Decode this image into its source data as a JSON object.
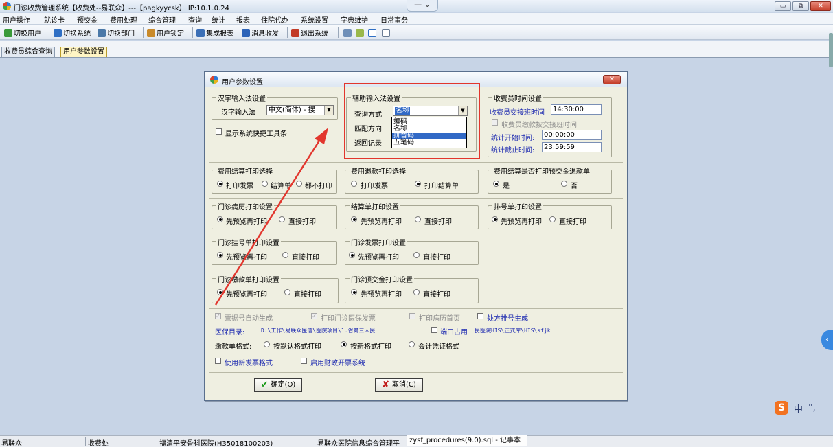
{
  "window": {
    "title": "门诊收费管理系统【收费处--易联众】---【pagkyycsk】 IP:10.1.0.24",
    "tab_controls": "—  ⌄",
    "buttons": {
      "minimize": "▭",
      "restore": "⧉",
      "close": "✕"
    }
  },
  "menu": [
    "用户操作",
    "就诊卡",
    "预交金",
    "费用处理",
    "综合管理",
    "查询",
    "统计",
    "报表",
    "住院代办",
    "系统设置",
    "字典维护",
    "日常事务"
  ],
  "toolbar": {
    "items": [
      {
        "label": "切换用户",
        "icon": "switch-user-icon",
        "color": "#3a9a3a"
      },
      {
        "label": "切换系统",
        "icon": "switch-system-icon",
        "color": "#2f6fc4"
      },
      {
        "label": "切换部门",
        "icon": "switch-department-icon",
        "color": "#4a78a8"
      },
      {
        "label": "用户锁定",
        "icon": "user-lock-icon",
        "color": "#c98a2a"
      },
      {
        "label": "集成报表",
        "icon": "report-icon",
        "color": "#3b6fb6"
      },
      {
        "label": "消息收发",
        "icon": "message-icon",
        "color": "#2c63b8"
      },
      {
        "label": "退出系统",
        "icon": "exit-icon",
        "color": "#c23a26"
      }
    ],
    "extra_icons": [
      "help-icon",
      "plugin-icon",
      "layout-icon",
      "window-icon"
    ]
  },
  "tabs": [
    "收费员综合查询",
    "用户参数设置"
  ],
  "dialog": {
    "title": "用户参数设置",
    "close_label": "✕",
    "ime_group": {
      "title": "汉字输入法设置",
      "label": "汉字输入法",
      "value": "中文(简体) - 搜",
      "show_toolbar": "显示系统快捷工具条"
    },
    "aux_group": {
      "title": "辅助输入法设置",
      "query_label": "查询方式",
      "query_value": "名称",
      "match_label": "匹配方向",
      "return_label": "返回记录",
      "options": [
        "编码",
        "名称",
        "拼音码",
        "五笔码"
      ]
    },
    "time_group": {
      "title": "收费员时间设置",
      "handover_label": "收费员交接班时间",
      "handover_value": "14:30:00",
      "pay_handover": "收费员缴款按交接班时间",
      "start_label": "统计开始时间:",
      "start_value": "00:00:00",
      "end_label": "统计截止时间:",
      "end_value": "23:59:59"
    },
    "settle_print": {
      "title": "费用结算打印选择",
      "options": [
        "打印发票",
        "结算单",
        "都不打印"
      ]
    },
    "refund_print": {
      "title": "费用退款打印选择",
      "options": [
        "打印发票",
        "打印结算单"
      ]
    },
    "deposit_refund": {
      "title": "费用结算是否打印预交金退款单",
      "options": [
        "是",
        "否"
      ]
    },
    "record_print": {
      "title": "门诊病历打印设置",
      "options": [
        "先预览再打印",
        "直接打印"
      ]
    },
    "bill_print": {
      "title": "结算单打印设置",
      "options": [
        "先预览再打印",
        "直接打印"
      ]
    },
    "queue_print": {
      "title": "排号单打印设置",
      "options": [
        "先预览再打印",
        "直接打印"
      ]
    },
    "reg_print": {
      "title": "门诊挂号单打印设置",
      "options": [
        "先预览再打印",
        "直接打印"
      ]
    },
    "invoice_print": {
      "title": "门诊发票打印设置",
      "options": [
        "先预览再打印",
        "直接打印"
      ]
    },
    "payment_print": {
      "title": "门诊缴款单打印设置",
      "options": [
        "先预览再打印",
        "直接打印"
      ]
    },
    "prepay_print": {
      "title": "门诊预交金打印设置",
      "options": [
        "先预览再打印",
        "直接打印"
      ]
    },
    "misc": {
      "auto_receipt": "票据号自动生成",
      "print_insurance": "打印门诊医保发票",
      "print_first_page": "打印病历首页",
      "prescription_queue": "处方排号生成",
      "insurance_dir_label": "医保目录:",
      "insurance_dir_value": "D:\\工作\\易联众医信\\医院项目\\1.省第三人民",
      "port_use": "端口占用",
      "port_path": "民医院HIS\\正式库\\HIS\\sfjk",
      "payment_format_label": "缴款单格式:",
      "payment_formats": [
        "按默认格式打印",
        "按新格式打印",
        "会计凭证格式"
      ],
      "new_invoice": "使用新发票格式",
      "finance_invoice": "启用财政开票系统"
    },
    "ok_label": "确定(O)",
    "cancel_label": "取消(C)"
  },
  "statusbar": {
    "cells": [
      "易联众",
      "收费处",
      "福清平安骨科医院(H35018100203)",
      "易联众医院信息综合管理平"
    ],
    "notepad": "zysf_procedures(9.0).sql - 记事本"
  },
  "ime": {
    "logo": "S",
    "mode": "中",
    "punct": "°,"
  },
  "side_tab_label": "‹",
  "annotation_color": "#e2362d"
}
